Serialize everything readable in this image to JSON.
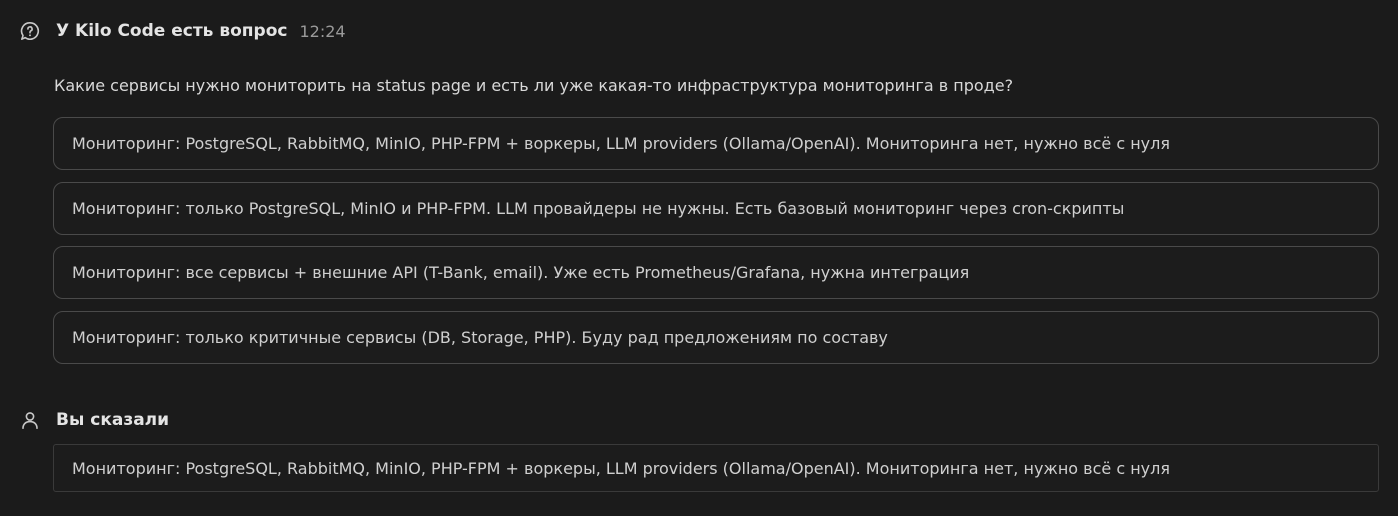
{
  "question": {
    "icon": "question-bubble-icon",
    "title": "У Kilo Code есть вопрос",
    "time": "12:24",
    "text": "Какие сервисы нужно мониторить на status page и есть ли уже какая-то инфраструктура мониторинга в проде?",
    "options": [
      "Мониторинг: PostgreSQL, RabbitMQ, MinIO, PHP-FPM + воркеры, LLM providers (Ollama/OpenAI). Мониторинга нет, нужно всё с нуля",
      "Мониторинг: только PostgreSQL, MinIO и PHP-FPM. LLM провайдеры не нужны. Есть базовый мониторинг через cron-скрипты",
      "Мониторинг: все сервисы + внешние API (T-Bank, email). Уже есть Prometheus/Grafana, нужна интеграция",
      "Мониторинг: только критичные сервисы (DB, Storage, PHP). Буду рад предложениям по составу"
    ]
  },
  "answer": {
    "icon": "user-icon",
    "title": "Вы сказали",
    "text": "Мониторинг: PostgreSQL, RabbitMQ, MinIO, PHP-FPM + воркеры, LLM providers (Ollama/OpenAI). Мониторинга нет, нужно всё с нуля"
  }
}
